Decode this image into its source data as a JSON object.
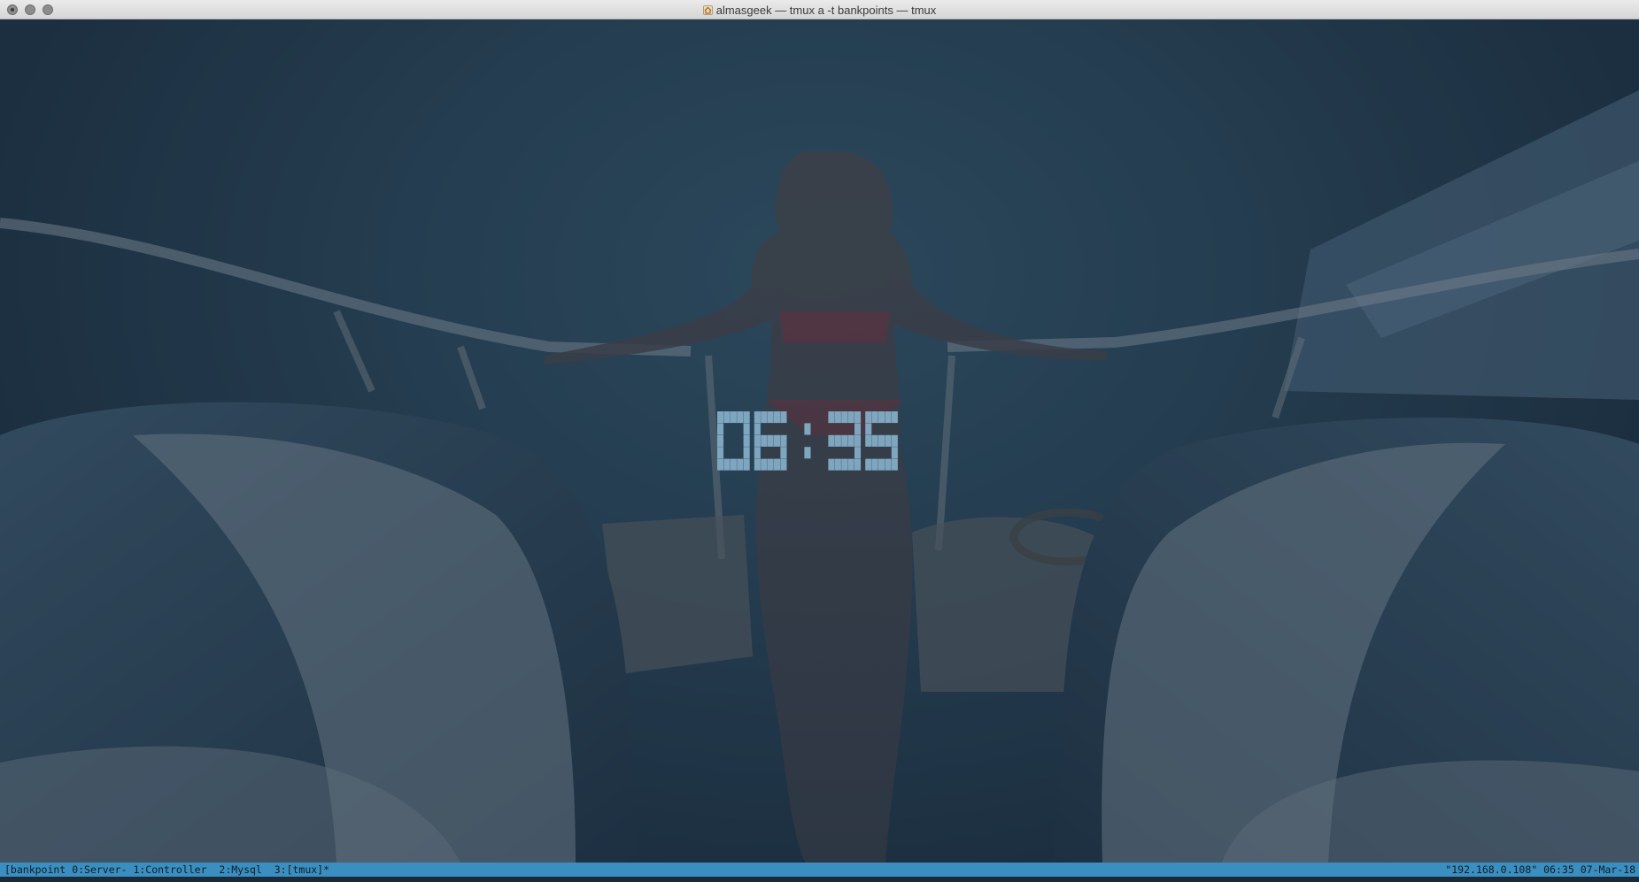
{
  "window": {
    "title": "almasgeek — tmux a -t bankpoints — tmux",
    "title_icon": "home-icon",
    "controls": [
      "close",
      "minimize",
      "zoom"
    ]
  },
  "clock": {
    "time": "06:35",
    "hours": "06",
    "minutes": "35",
    "color": "#7fa6bf"
  },
  "statusbar": {
    "session": "[bankpoint",
    "windows": [
      {
        "label": "0:Server-"
      },
      {
        "label": "1:Controller"
      },
      {
        "label": "2:Mysql"
      },
      {
        "label": "3:[tmux]*"
      }
    ],
    "host": "\"192.168.0.108\"",
    "time": "06:35",
    "date": "07-Mar-18",
    "background_color": "#3b8fc0"
  }
}
